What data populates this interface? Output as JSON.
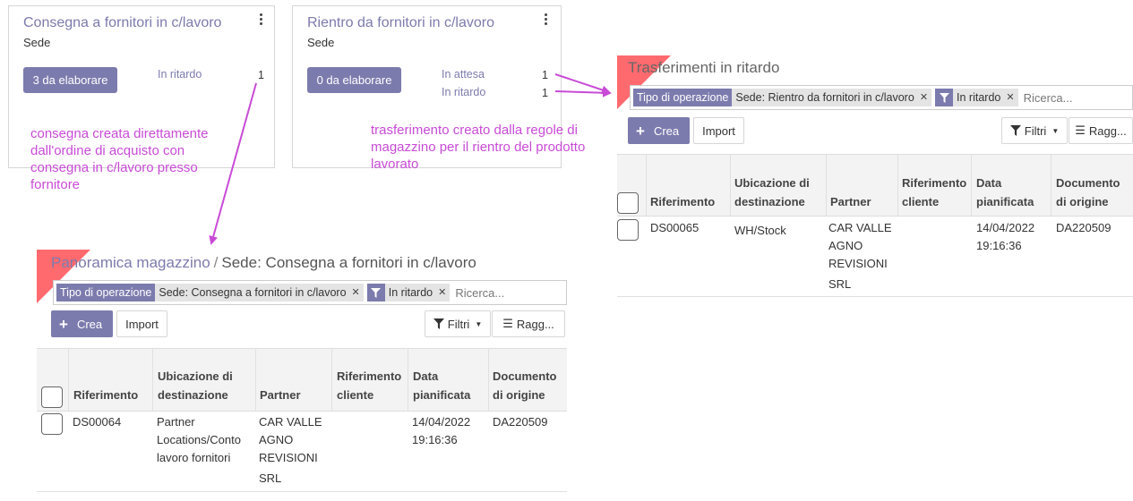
{
  "card1": {
    "title": "Consegna a fornitori in c/lavoro",
    "subtitle": "Sede",
    "button": "3 da elaborare",
    "stats": [
      {
        "label": "In ritardo",
        "value": "1"
      }
    ]
  },
  "card2": {
    "title": "Rientro da fornitori in c/lavoro",
    "subtitle": "Sede",
    "button": "0 da elaborare",
    "stats": [
      {
        "label": "In attesa",
        "value": "1"
      },
      {
        "label": "In ritardo",
        "value": "1"
      }
    ]
  },
  "notes": {
    "left": [
      "consegna creata direttamente",
      "dall'ordine di acquisto con",
      "consegna in c/lavoro presso",
      "fornitore"
    ],
    "right": [
      "trasferimento creato dalla regole di",
      "magazzino per il rientro del prodotto",
      "lavorato"
    ]
  },
  "right_panel": {
    "title": "Trasferimenti in ritardo",
    "facet1_label": "Tipo di operazione",
    "facet1_value": "Sede: Rientro da fornitori in c/lavoro",
    "facet2_value": "In ritardo",
    "search_placeholder": "Ricerca...",
    "create": "Crea",
    "import": "Import",
    "filters": "Filtri",
    "group": "Ragg...",
    "columns": {
      "ref": "Riferimento",
      "dest": [
        "Ubicazione di",
        "destinazione"
      ],
      "partner": "Partner",
      "client_ref": [
        "Riferimento",
        "cliente"
      ],
      "date": [
        "Data",
        "pianificata"
      ],
      "origin": [
        "Documento",
        "di origine"
      ]
    },
    "row": {
      "ref": "DS00065",
      "dest": [
        "WH/Stock"
      ],
      "partner": [
        "CAR VALLE",
        "AGNO",
        "REVISIONI",
        "SRL"
      ],
      "date": [
        "14/04/2022",
        "19:16:36"
      ],
      "origin": "DA220509"
    }
  },
  "left_panel": {
    "breadcrumb_link": "Panoramica magazzino",
    "breadcrumb_sep": "/",
    "breadcrumb_current": "Sede: Consegna a fornitori in c/lavoro",
    "facet1_label": "Tipo di operazione",
    "facet1_value": "Sede: Consegna a fornitori in c/lavoro",
    "facet2_value": "In ritardo",
    "search_placeholder": "Ricerca...",
    "create": "Crea",
    "import": "Import",
    "filters": "Filtri",
    "group": "Ragg...",
    "columns": {
      "ref": "Riferimento",
      "dest": [
        "Ubicazione di",
        "destinazione"
      ],
      "partner": "Partner",
      "client_ref": [
        "Riferimento",
        "cliente"
      ],
      "date": [
        "Data",
        "pianificata"
      ],
      "origin": [
        "Documento",
        "di origine"
      ]
    },
    "row": {
      "ref": "DS00064",
      "dest": [
        "Partner",
        "Locations/Conto",
        "lavoro fornitori"
      ],
      "partner": [
        "CAR VALLE",
        "AGNO",
        "REVISIONI",
        "SRL"
      ],
      "date": [
        "14/04/2022",
        "19:16:36"
      ],
      "origin": "DA220509"
    }
  },
  "colors": {
    "accent": "#7c7bad",
    "annotation": "#c84bd6",
    "ribbon": "#ff5a5f"
  },
  "icons": [
    "kebab-menu-icon",
    "plus-icon",
    "filter-icon",
    "list-icon",
    "close-icon",
    "caret-down-icon"
  ]
}
